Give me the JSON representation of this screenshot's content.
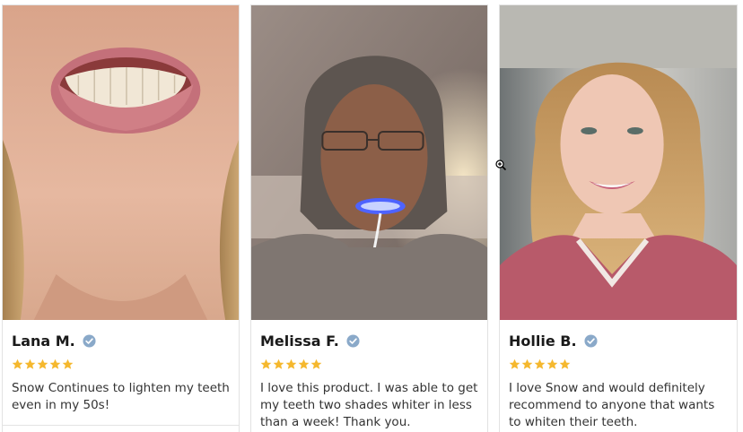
{
  "reviews": [
    {
      "name": "Lana M.",
      "verified_icon": "verified-check-icon",
      "rating": 5,
      "text": "Snow Continues to lighten my teeth even in my 50s!",
      "photo": "smile-closeup-photo"
    },
    {
      "name": "Melissa F.",
      "verified_icon": "verified-check-icon",
      "rating": 5,
      "text": "I love this product. I was able to get my teeth two shades whiter in less than a week!  Thank you.",
      "photo": "led-whitening-device-photo"
    },
    {
      "name": "Hollie B.",
      "verified_icon": "verified-check-icon",
      "rating": 5,
      "text": "I love Snow and would definitely recommend to anyone that wants to whiten their teeth.",
      "photo": "selfie-smile-photo"
    }
  ],
  "colors": {
    "star": "#f5b82e",
    "verified": "#8aa9c9",
    "name": "#1a1a1a",
    "text": "#333333"
  },
  "cursor_icon": "zoom-in-cursor-icon"
}
